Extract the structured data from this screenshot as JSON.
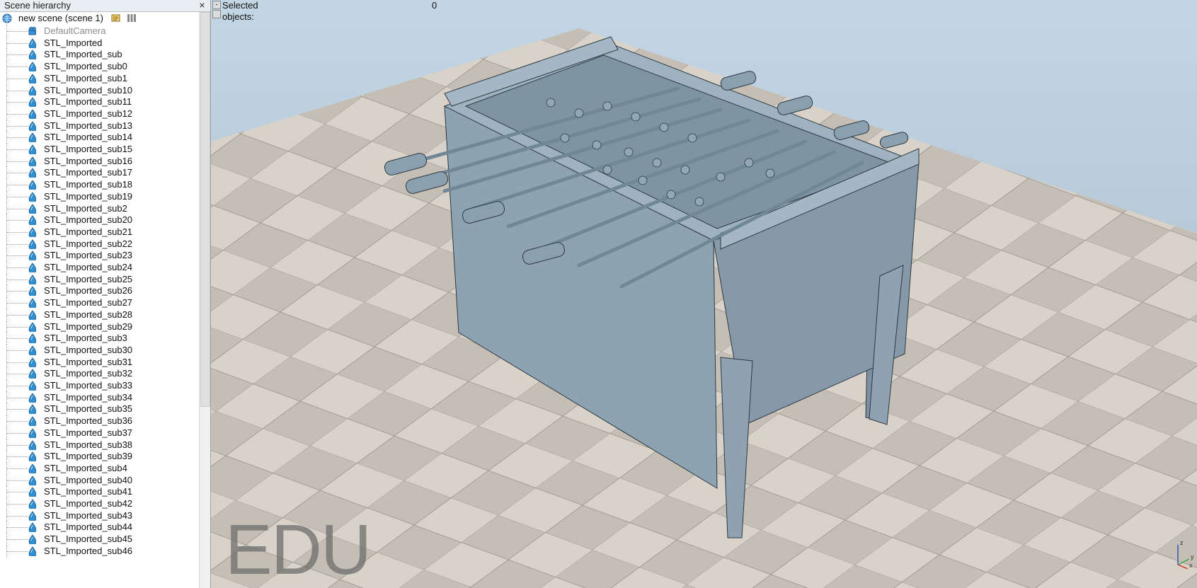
{
  "hierarchy": {
    "title": "Scene hierarchy",
    "close_glyph": "×",
    "root": {
      "label": "new scene (scene 1)"
    },
    "items": [
      {
        "label": "DefaultCamera",
        "kind": "camera"
      },
      {
        "label": "STL_Imported",
        "kind": "shape"
      },
      {
        "label": "STL_Imported_sub",
        "kind": "shape"
      },
      {
        "label": "STL_Imported_sub0",
        "kind": "shape"
      },
      {
        "label": "STL_Imported_sub1",
        "kind": "shape"
      },
      {
        "label": "STL_Imported_sub10",
        "kind": "shape"
      },
      {
        "label": "STL_Imported_sub11",
        "kind": "shape"
      },
      {
        "label": "STL_Imported_sub12",
        "kind": "shape"
      },
      {
        "label": "STL_Imported_sub13",
        "kind": "shape"
      },
      {
        "label": "STL_Imported_sub14",
        "kind": "shape"
      },
      {
        "label": "STL_Imported_sub15",
        "kind": "shape"
      },
      {
        "label": "STL_Imported_sub16",
        "kind": "shape"
      },
      {
        "label": "STL_Imported_sub17",
        "kind": "shape"
      },
      {
        "label": "STL_Imported_sub18",
        "kind": "shape"
      },
      {
        "label": "STL_Imported_sub19",
        "kind": "shape"
      },
      {
        "label": "STL_Imported_sub2",
        "kind": "shape"
      },
      {
        "label": "STL_Imported_sub20",
        "kind": "shape"
      },
      {
        "label": "STL_Imported_sub21",
        "kind": "shape"
      },
      {
        "label": "STL_Imported_sub22",
        "kind": "shape"
      },
      {
        "label": "STL_Imported_sub23",
        "kind": "shape"
      },
      {
        "label": "STL_Imported_sub24",
        "kind": "shape"
      },
      {
        "label": "STL_Imported_sub25",
        "kind": "shape"
      },
      {
        "label": "STL_Imported_sub26",
        "kind": "shape"
      },
      {
        "label": "STL_Imported_sub27",
        "kind": "shape"
      },
      {
        "label": "STL_Imported_sub28",
        "kind": "shape"
      },
      {
        "label": "STL_Imported_sub29",
        "kind": "shape"
      },
      {
        "label": "STL_Imported_sub3",
        "kind": "shape"
      },
      {
        "label": "STL_Imported_sub30",
        "kind": "shape"
      },
      {
        "label": "STL_Imported_sub31",
        "kind": "shape"
      },
      {
        "label": "STL_Imported_sub32",
        "kind": "shape"
      },
      {
        "label": "STL_Imported_sub33",
        "kind": "shape"
      },
      {
        "label": "STL_Imported_sub34",
        "kind": "shape"
      },
      {
        "label": "STL_Imported_sub35",
        "kind": "shape"
      },
      {
        "label": "STL_Imported_sub36",
        "kind": "shape"
      },
      {
        "label": "STL_Imported_sub37",
        "kind": "shape"
      },
      {
        "label": "STL_Imported_sub38",
        "kind": "shape"
      },
      {
        "label": "STL_Imported_sub39",
        "kind": "shape"
      },
      {
        "label": "STL_Imported_sub4",
        "kind": "shape"
      },
      {
        "label": "STL_Imported_sub40",
        "kind": "shape"
      },
      {
        "label": "STL_Imported_sub41",
        "kind": "shape"
      },
      {
        "label": "STL_Imported_sub42",
        "kind": "shape"
      },
      {
        "label": "STL_Imported_sub43",
        "kind": "shape"
      },
      {
        "label": "STL_Imported_sub44",
        "kind": "shape"
      },
      {
        "label": "STL_Imported_sub45",
        "kind": "shape"
      },
      {
        "label": "STL_Imported_sub46",
        "kind": "shape"
      }
    ]
  },
  "viewport": {
    "selected_label": "Selected objects:",
    "selected_count": "0",
    "watermark": "EDU",
    "axes": {
      "z": "z",
      "y": "y",
      "x": "x"
    }
  },
  "colors": {
    "table": "#8fa3b2",
    "table_dark": "#7a8e9c",
    "floor_light": "#d9d4ca",
    "floor_dark": "#bcb7ad",
    "sky_top": "#c3d4e2"
  }
}
